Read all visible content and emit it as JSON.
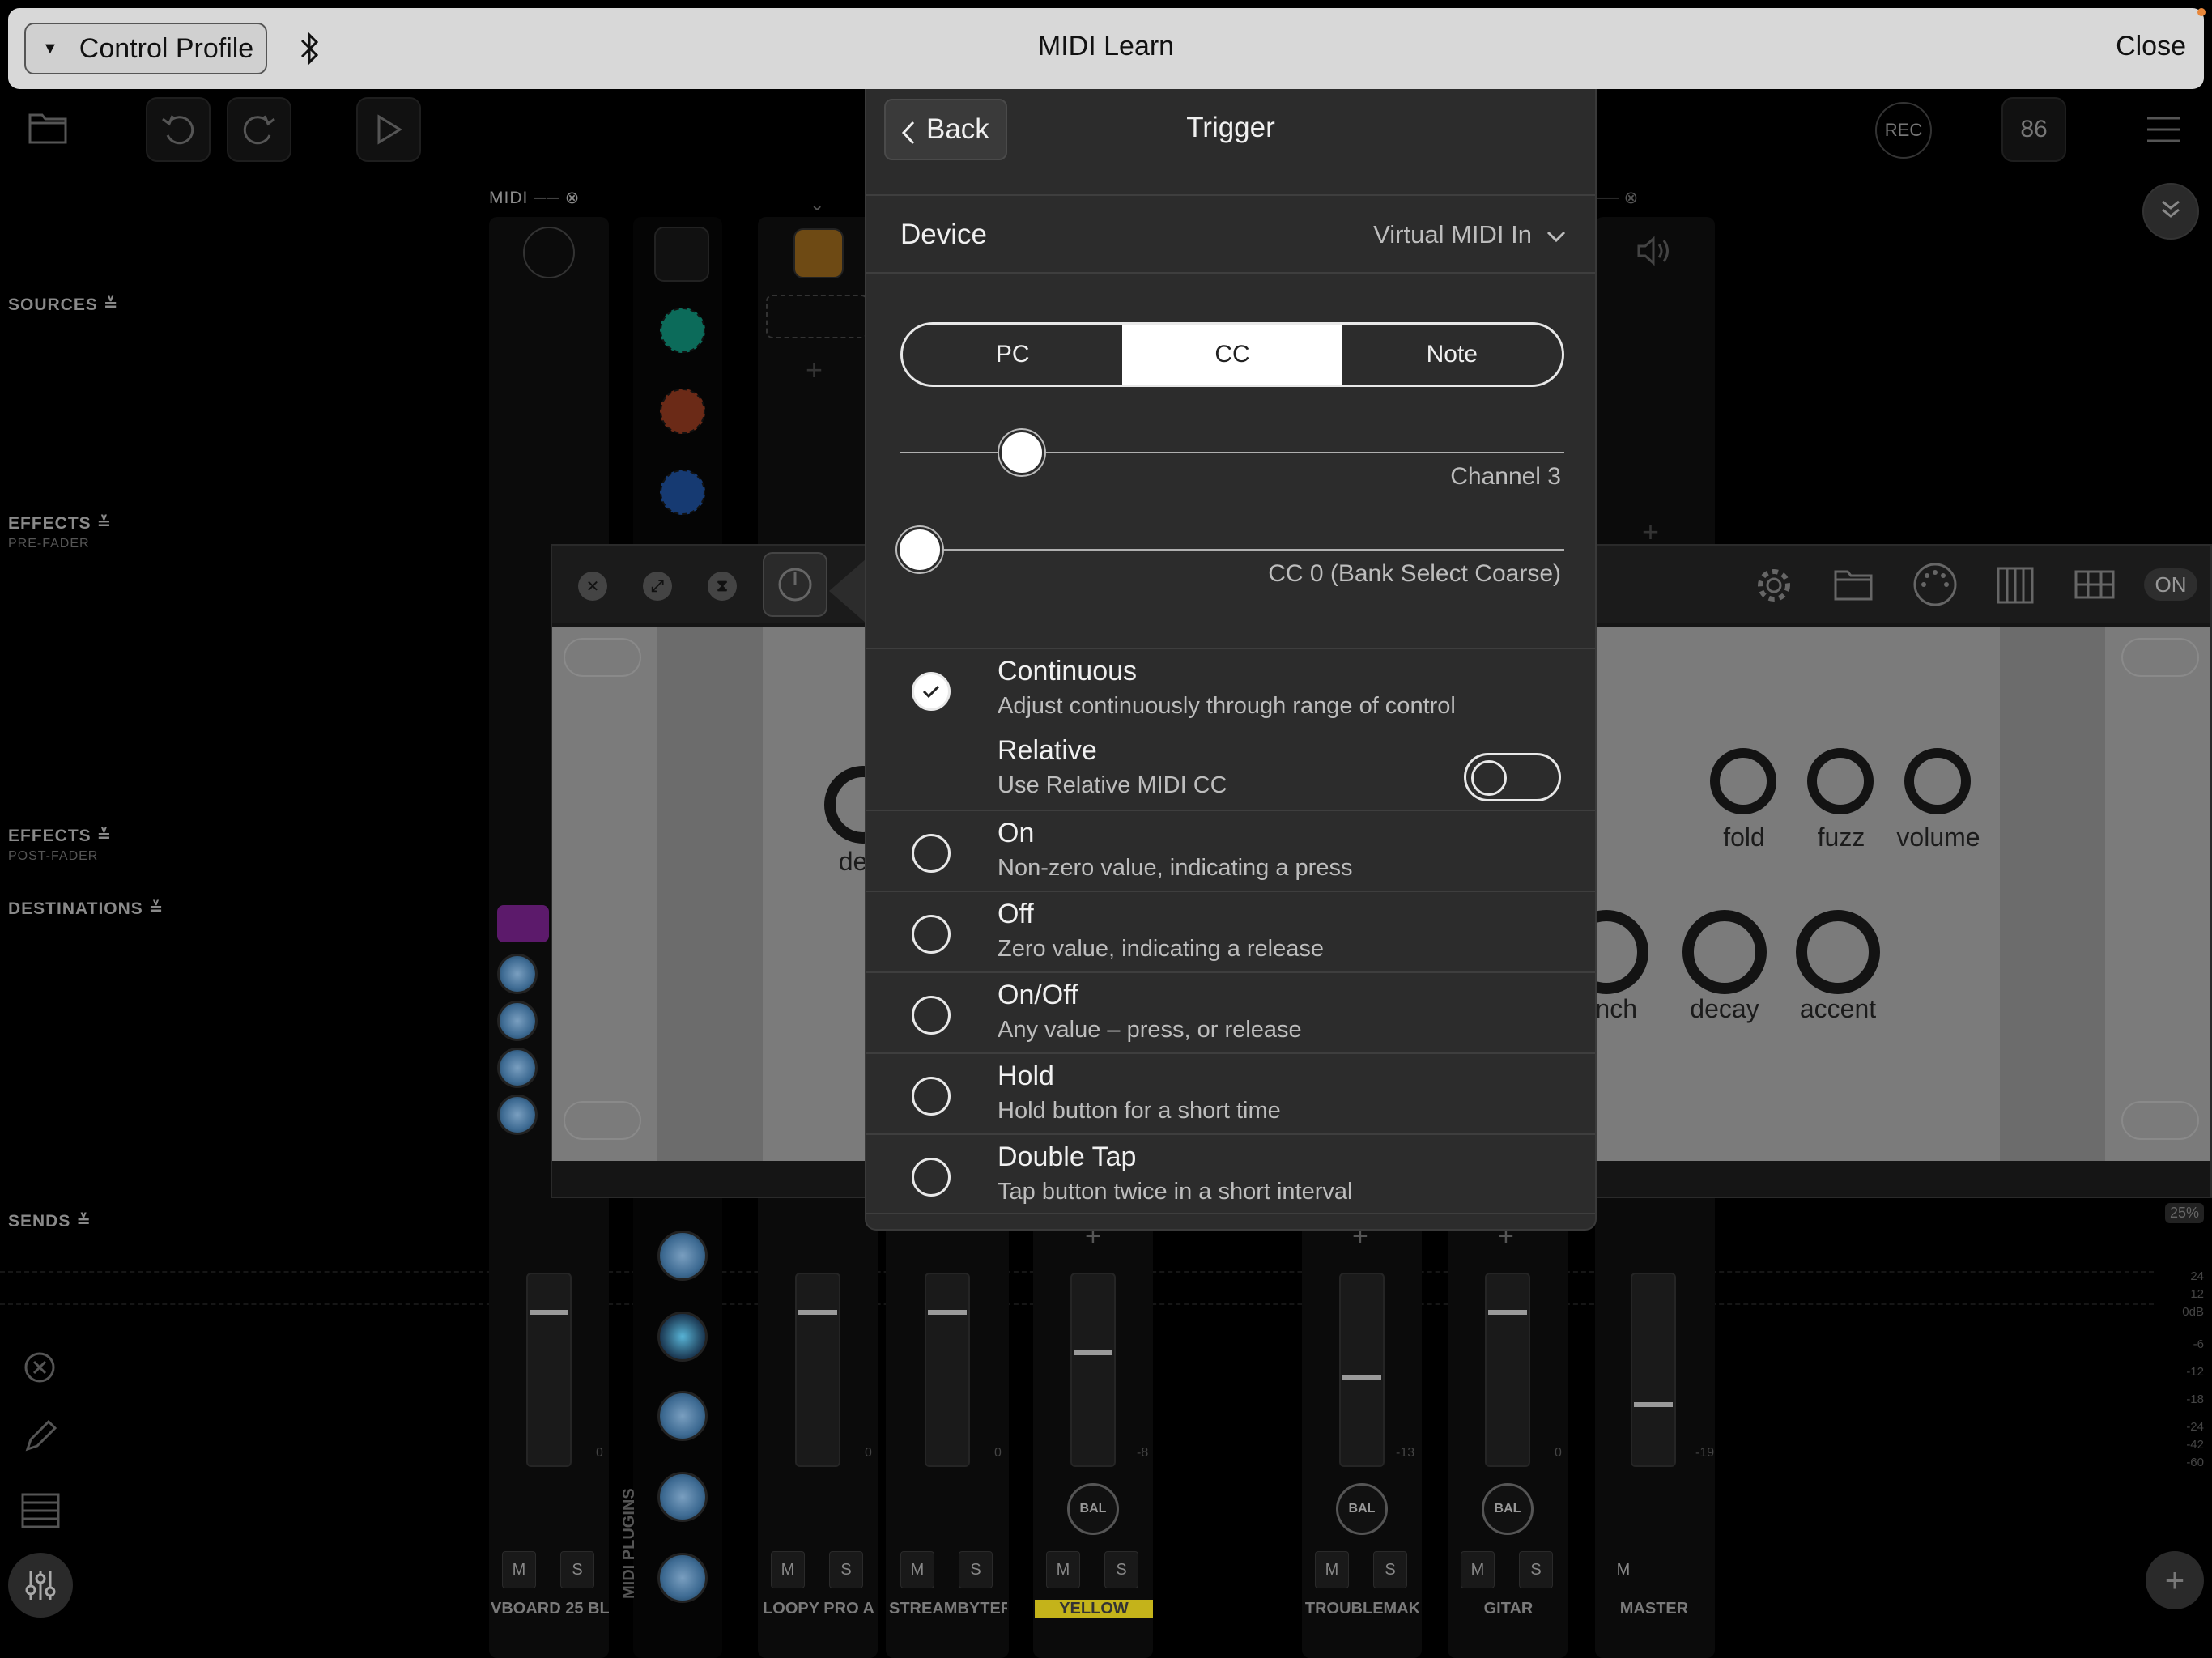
{
  "topbar": {
    "profile_label": "Control Profile",
    "title": "MIDI Learn",
    "close_label": "Close"
  },
  "toolbar": {
    "rec_label": "REC",
    "bpm": "86"
  },
  "mixer": {
    "midi_label": "MIDI",
    "sections": {
      "sources": "SOURCES",
      "effects_pre": "EFFECTS",
      "pre_fader": "PRE-FADER",
      "effects_post": "EFFECTS",
      "post_fader": "POST-FADER",
      "destinations": "DESTINATIONS",
      "sends": "SENDS"
    },
    "midi_plugins_label": "MIDI PLUGINS",
    "zoom": "25%",
    "meter_scale": [
      "24",
      "12",
      "0dB",
      "-6",
      "-12",
      "-18",
      "-24",
      "-42",
      "-60"
    ],
    "channels": [
      {
        "name": "VBOARD 25 BL",
        "db": "0",
        "m": "M",
        "s": "S"
      },
      {
        "name": "LOOPY PRO A",
        "db": "0",
        "m": "M",
        "s": "S"
      },
      {
        "name": "STREAMBYTER",
        "db": "0",
        "m": "M",
        "s": "S"
      },
      {
        "name": "YELLOW",
        "db": "-8",
        "m": "M",
        "s": "S",
        "bal": "BAL"
      },
      {
        "name": "TROUBLEMAK",
        "db": "-13",
        "m": "M",
        "s": "S",
        "bal": "BAL"
      },
      {
        "name": "GITAR",
        "db": "0",
        "m": "M",
        "s": "S",
        "bal": "BAL"
      },
      {
        "name": "MASTER",
        "db": "-19",
        "m": "M"
      }
    ]
  },
  "plugin": {
    "on_label": "ON",
    "knobs": {
      "del": "dela",
      "fold": "fold",
      "fuzz": "fuzz",
      "volume": "volume",
      "punch": "nch",
      "decay": "decay",
      "accent": "accent"
    }
  },
  "midi_learn": {
    "back_label": "Back",
    "title": "Trigger",
    "device_label": "Device",
    "device_value": "Virtual MIDI In",
    "message_types": [
      "PC",
      "CC",
      "Note"
    ],
    "selected_type": "CC",
    "channel_label": "Channel 3",
    "channel_fraction": 0.154,
    "cc_label": "CC 0 (Bank Select Coarse)",
    "cc_fraction": 0.0,
    "options": [
      {
        "title": "Continuous",
        "desc": "Adjust continuously through range of control",
        "selected": true
      },
      {
        "title": "Relative",
        "desc": "Use Relative MIDI CC",
        "toggle": false
      },
      {
        "title": "On",
        "desc": "Non-zero value, indicating a press"
      },
      {
        "title": "Off",
        "desc": "Zero value, indicating a release"
      },
      {
        "title": "On/Off",
        "desc": "Any value – press, or release"
      },
      {
        "title": "Hold",
        "desc": "Hold button for a short time"
      },
      {
        "title": "Double Tap",
        "desc": "Tap button twice in a short interval"
      }
    ]
  }
}
